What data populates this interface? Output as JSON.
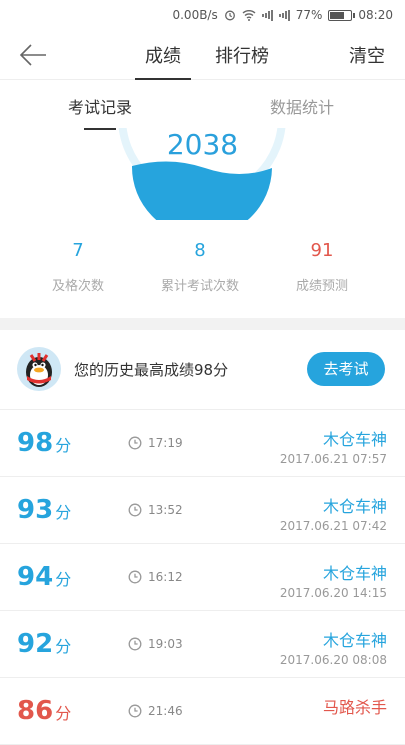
{
  "status_bar": {
    "net_speed": "0.00B/s",
    "battery_percent": "77%",
    "battery_level": 0.77,
    "time": "08:20",
    "icons": [
      "alarm-icon",
      "wifi-icon",
      "signal-icon",
      "signal-icon",
      "battery-icon"
    ]
  },
  "header": {
    "back_icon": "arrow-left-icon",
    "tabs": [
      {
        "label": "成绩",
        "active": true
      },
      {
        "label": "排行榜",
        "active": false
      }
    ],
    "clear_label": "清空"
  },
  "subtabs": [
    {
      "label": "考试记录",
      "active": true
    },
    {
      "label": "数据统计",
      "active": false
    }
  ],
  "gauge": {
    "value": "2038"
  },
  "stats": [
    {
      "value": "7",
      "label": "及格次数",
      "color": "#26a4dd"
    },
    {
      "value": "8",
      "label": "累计考试次数",
      "color": "#26a4dd"
    },
    {
      "value": "91",
      "label": "成绩预测",
      "color": "#e2574c"
    }
  ],
  "best": {
    "text": "您的历史最高成绩98分",
    "button_label": "去考试",
    "avatar_icon": "penguin-avatar-icon"
  },
  "records": [
    {
      "score": "98",
      "unit": "分",
      "duration": "17:19",
      "title": "木仓车神",
      "date": "2017.06.21  07:57",
      "color": "blue"
    },
    {
      "score": "93",
      "unit": "分",
      "duration": "13:52",
      "title": "木仓车神",
      "date": "2017.06.21  07:42",
      "color": "blue"
    },
    {
      "score": "94",
      "unit": "分",
      "duration": "16:12",
      "title": "木仓车神",
      "date": "2017.06.20  14:15",
      "color": "blue"
    },
    {
      "score": "92",
      "unit": "分",
      "duration": "19:03",
      "title": "木仓车神",
      "date": "2017.06.20  08:08",
      "color": "blue"
    },
    {
      "score": "86",
      "unit": "分",
      "duration": "21:46",
      "title": "马路杀手",
      "date": "",
      "color": "red"
    }
  ],
  "colors": {
    "accent": "#26a4dd",
    "warning": "#e2574c"
  }
}
